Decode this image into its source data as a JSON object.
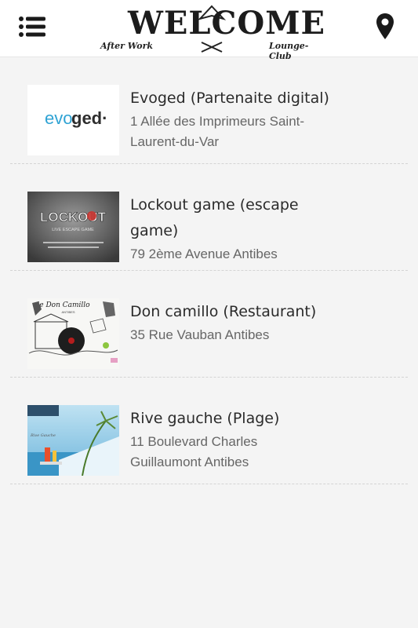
{
  "header": {
    "menu_icon": "hamburger-menu-icon",
    "location_icon": "map-pin-icon",
    "logo": {
      "word": "WELCOME",
      "left_tag": "After Work",
      "right_tag": "Lounge-Club"
    },
    "colors": {
      "background": "#ffffff",
      "icon": "#1a1a1a"
    }
  },
  "places": [
    {
      "title": "Evoged (Partenaite digital)",
      "address": "1 Allée des Imprimeurs Saint-Laurent-du-Var",
      "thumb": {
        "logo_part1": "evo",
        "logo_part2": "ged·"
      }
    },
    {
      "title": "Lockout game (escape game)",
      "address": "79 2ème Avenue Antibes",
      "thumb": {
        "brand": "LOCKOUT",
        "tagline": "LIVE ESCAPE GAME"
      }
    },
    {
      "title": "Don camillo (Restaurant)",
      "address": "35 Rue Vauban Antibes",
      "thumb": {
        "brand": "le Don Camillo",
        "sub": "ANTIBES"
      }
    },
    {
      "title": "Rive gauche (Plage)",
      "address": "11 Boulevard Charles Guillaumont Antibes",
      "thumb": {
        "sign": "Rive Gauche"
      }
    }
  ],
  "colors": {
    "page_background": "#f4f4f4",
    "title": "#2b2b2b",
    "address": "#666666",
    "divider": "#d4d4d4"
  }
}
